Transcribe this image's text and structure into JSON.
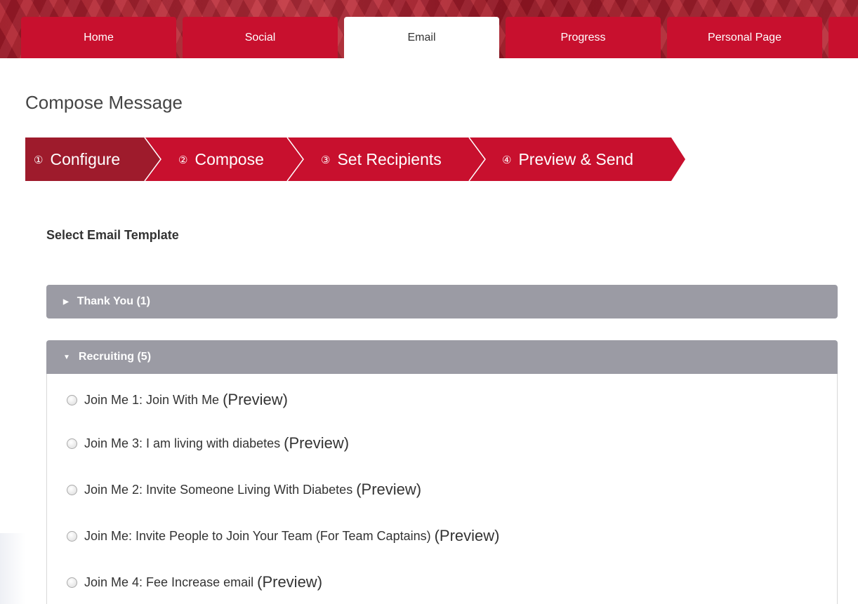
{
  "tabs": [
    {
      "label": "Home"
    },
    {
      "label": "Social"
    },
    {
      "label": "Email"
    },
    {
      "label": "Progress"
    },
    {
      "label": "Personal Page"
    }
  ],
  "page_title": "Compose Message",
  "wizard": {
    "steps": [
      {
        "num": "①",
        "label": "Configure"
      },
      {
        "num": "②",
        "label": "Compose"
      },
      {
        "num": "③",
        "label": "Set Recipients"
      },
      {
        "num": "④",
        "label": "Preview & Send"
      }
    ],
    "active_color": "#9e1b2c",
    "step_color": "#c8102e"
  },
  "section_label": "Select Email Template",
  "accordions": [
    {
      "label": "Thank You (1)"
    },
    {
      "label": "Recruiting (5)"
    }
  ],
  "templates": [
    {
      "name": "Join Me 1: Join With Me",
      "preview": "(Preview)"
    },
    {
      "name": "Join Me 3: I am living with diabetes",
      "preview": "(Preview)"
    },
    {
      "name": "Join Me 2: Invite Someone Living With Diabetes",
      "preview": "(Preview)"
    },
    {
      "name": "Join Me: Invite People to Join Your Team (For Team Captains)",
      "preview": "(Preview)"
    },
    {
      "name": "Join Me 4: Fee Increase email",
      "preview": "(Preview)"
    }
  ],
  "colors": {
    "brand": "#c8102e",
    "accordion": "#9b9ba4"
  }
}
